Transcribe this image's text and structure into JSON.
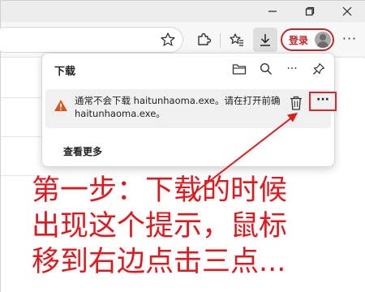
{
  "toolbar": {
    "login_label": "登录",
    "more_label": "···"
  },
  "download_panel": {
    "title": "下载",
    "item": {
      "line1": "通常不会下载 haitunhaoma.exe。请在打开前确",
      "line2": "haitunhaoma.exe。",
      "more_label": "···"
    },
    "see_more": "查看更多"
  },
  "annotation": {
    "line1": "第一步：下载的时候",
    "line2": "出现这个提示，鼠标",
    "line3": "移到右边点击三点..."
  },
  "colors": {
    "annotation_red": "#e0191f",
    "warning_orange": "#d9541e",
    "login_red": "#c0282d"
  },
  "icons": [
    "minimize-icon",
    "maximize-icon",
    "close-icon",
    "favorite-star-icon",
    "extensions-icon",
    "favorites-icon",
    "download-icon",
    "profile-avatar",
    "more-icon",
    "folder-icon",
    "search-icon",
    "pin-icon",
    "warning-icon",
    "trash-icon"
  ]
}
